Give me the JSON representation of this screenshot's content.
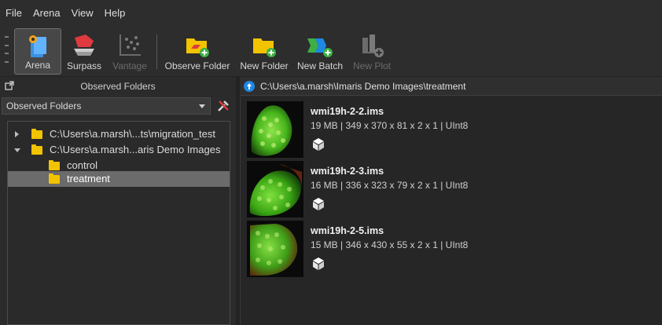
{
  "menubar": {
    "items": [
      "File",
      "Arena",
      "View",
      "Help"
    ]
  },
  "toolbar": {
    "arena_label": "Arena",
    "surpass_label": "Surpass",
    "vantage_label": "Vantage",
    "observe_folder_label": "Observe Folder",
    "new_folder_label": "New Folder",
    "new_batch_label": "New Batch",
    "new_plot_label": "New Plot"
  },
  "left_panel": {
    "title": "Observed Folders",
    "select_value": "Observed Folders",
    "tree": [
      {
        "label": "C:\\Users\\a.marsh\\...ts\\migration_test",
        "expanded": false,
        "selected": false
      },
      {
        "label": "C:\\Users\\a.marsh...aris Demo Images",
        "expanded": true,
        "selected": false
      },
      {
        "label": "control",
        "expanded": false,
        "selected": false
      },
      {
        "label": "treatment",
        "expanded": false,
        "selected": true
      }
    ]
  },
  "right_panel": {
    "path": "C:\\Users\\a.marsh\\Imaris Demo Images\\treatment",
    "files": [
      {
        "name": "wmi19h-2-2.ims",
        "meta": "19 MB | 349 x 370 x 81 x 2 x 1 | UInt8"
      },
      {
        "name": "wmi19h-2-3.ims",
        "meta": "16 MB | 336 x 323 x 79 x 2 x 1 | UInt8"
      },
      {
        "name": "wmi19h-2-5.ims",
        "meta": "15 MB | 346 x 430 x 55 x 2 x 1 | UInt8"
      }
    ]
  },
  "colors": {
    "folder": "#f2c300",
    "accent_blue": "#1e88e5",
    "selection": "#6b6b6b",
    "toolbar_green": "#3cb043"
  }
}
